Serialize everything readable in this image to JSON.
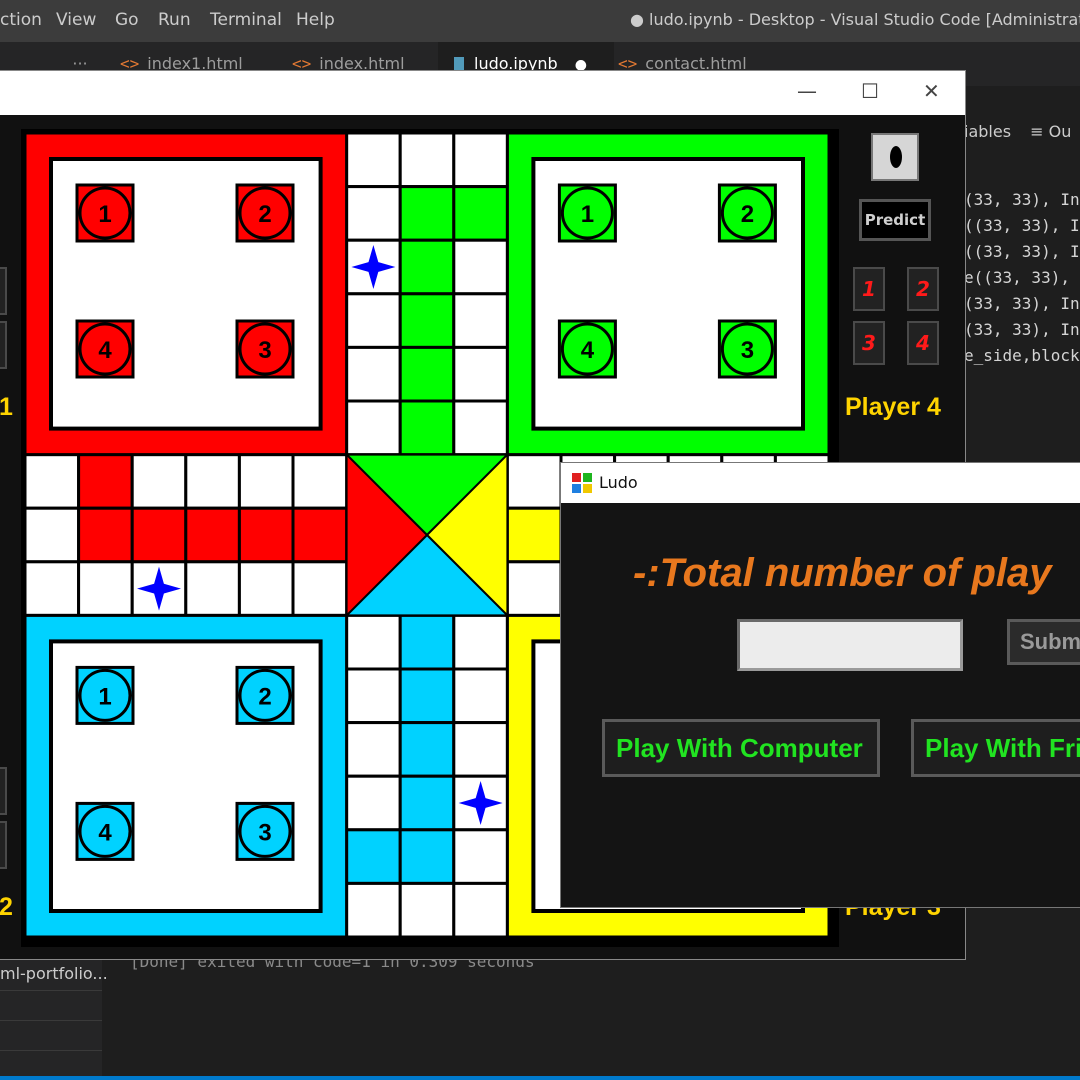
{
  "vscode": {
    "menu": [
      "ction",
      "View",
      "Go",
      "Run",
      "Terminal",
      "Help"
    ],
    "title": "● ludo.ipynb - Desktop - Visual Studio Code [Administrator]",
    "overflow_label": "···",
    "tabs": [
      {
        "label": "index1.html",
        "icon": "html-tag-icon"
      },
      {
        "label": "index.html",
        "icon": "html-tag-icon"
      },
      {
        "label": "ludo.ipynb",
        "icon": "notebook-icon",
        "active": true,
        "dirty_marker": "●"
      },
      {
        "label": "contact.html",
        "icon": "html-tag-icon"
      }
    ],
    "notebook_toolbar": {
      "variables": "iables",
      "outline": "≡ Ou"
    },
    "code_lines": [
      "(33, 33), In",
      "((33, 33), I",
      "((33, 33), I",
      "e((33, 33),",
      "(33, 33), In",
      "(33, 33), In",
      "e_side,block"
    ],
    "terminal_output": "[Done] exited with code=1 in 0.309 seconds",
    "explorer_item": "ml-portfolio..."
  },
  "ludo_window": {
    "controls": {
      "minimize": "—",
      "maximize": "☐",
      "close": "✕"
    },
    "side_panel": {
      "dice_value": 1,
      "predict_label": "Predict",
      "player4_buttons": [
        "1",
        "2",
        "3",
        "4"
      ],
      "player4_label": "Player 4",
      "player3_label": "Player 3",
      "player1_label_partial": "1",
      "player2_label_partial": "2"
    },
    "board": {
      "colors": {
        "red": "#ff0000",
        "green": "#00ff00",
        "blue": "#00d2ff",
        "yellow": "#ffff00",
        "star": "#0000ff",
        "track_border": "#000000"
      },
      "home_tokens": {
        "red": [
          "1",
          "2",
          "4",
          "3"
        ],
        "green": [
          "1",
          "2",
          "4",
          "3"
        ],
        "blue": [
          "1",
          "2",
          "4",
          "3"
        ]
      }
    }
  },
  "dialog": {
    "title": "Ludo",
    "prompt": "-:Total number of play",
    "input_value": "",
    "submit_label": "Submit",
    "buttons": [
      "Play With Computer",
      "Play With Friends"
    ],
    "colors": {
      "prompt": "#e8781e",
      "button_text": "#21e421"
    }
  }
}
